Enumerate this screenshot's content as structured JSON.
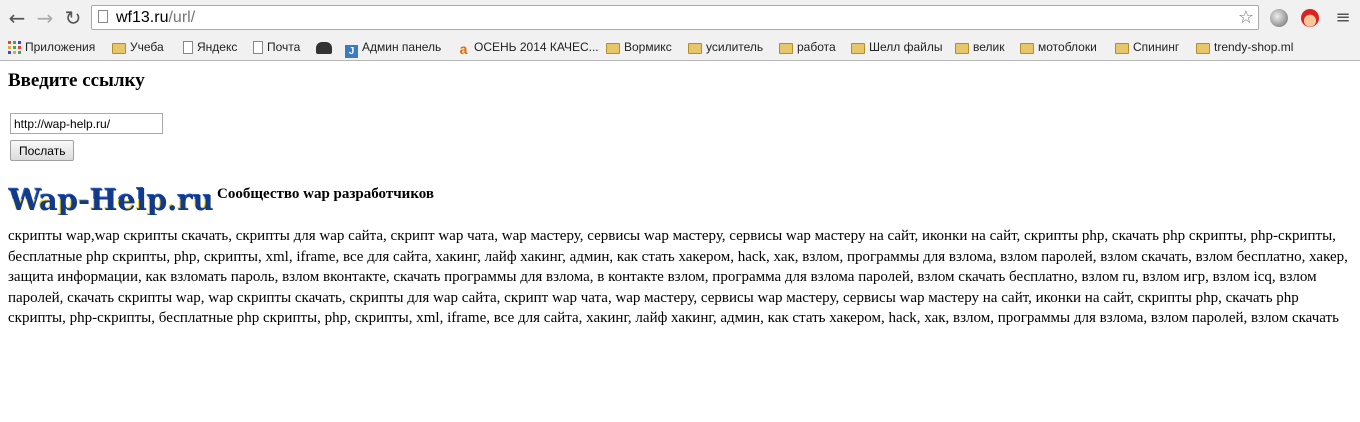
{
  "browser": {
    "url_host": "wf13.ru",
    "url_path": "/url/",
    "icons": [
      "back-icon",
      "forward-icon",
      "reload-icon",
      "star-icon",
      "globe-icon",
      "santa-icon",
      "menu-icon"
    ]
  },
  "bookmarks": [
    {
      "label": "Приложения",
      "icon": "apps-grid-icon"
    },
    {
      "label": "Учеба",
      "icon": "folder-icon"
    },
    {
      "label": "Яндекс",
      "icon": "page-icon"
    },
    {
      "label": "Почта",
      "icon": "page-icon"
    },
    {
      "label": "",
      "icon": "spy-icon"
    },
    {
      "label": "Админ панель",
      "icon": "joomla-icon"
    },
    {
      "label": "ОСЕНЬ 2014 КАЧЕС...",
      "icon": "a-letter-icon"
    },
    {
      "label": "Вормикс",
      "icon": "folder-icon"
    },
    {
      "label": "усилитель",
      "icon": "folder-icon"
    },
    {
      "label": "работа",
      "icon": "folder-icon"
    },
    {
      "label": "Шелл файлы",
      "icon": "folder-icon"
    },
    {
      "label": "велик",
      "icon": "folder-icon"
    },
    {
      "label": "мотоблоки",
      "icon": "folder-icon"
    },
    {
      "label": "Спининг",
      "icon": "folder-icon"
    },
    {
      "label": "trendy-shop.ml",
      "icon": "folder-icon"
    }
  ],
  "page": {
    "heading": "Введите ссылку",
    "input_value": "http://wap-help.ru/",
    "submit_label": "Послать",
    "logo_text": "Wap-Help.ru",
    "tagline": "Сообщество wap разработчиков",
    "keywords": "скрипты wap,wap скрипты скачать, скрипты для wap сайта, скрипт wap чата, wap мастеру, сервисы wap мастеру, сервисы wap мастеру на сайт, иконки на сайт, скрипты php, скачать php скрипты, php-скрипты, бесплатные php скрипты, php, скрипты, xml, iframe, все для сайта, хакинг, лайф хакинг, админ, как стать хакером, hack, хак, взлом, программы для взлома, взлом паролей, взлом скачать, взлом бесплатно, хакер, защита информации, как взломать пароль, взлом вконтакте, скачать программы для взлома, в контакте взлом, программа для взлома паролей, взлом скачать бесплатно, взлом ru, взлом игр, взлом icq, взлом паролей, скачать скрипты wap, wap скрипты скачать, скрипты для wap сайта, скрипт wap чата, wap мастеру, сервисы wap мастеру, сервисы wap мастеру на сайт, иконки на сайт, скрипты php, скачать php скрипты, php-скрипты, бесплатные php скрипты, php, скрипты, xml, iframe, все для сайта, хакинг, лайф хакинг, админ, как стать хакером, hack, хак, взлом, программы для взлома, взлом паролей, взлом скачать"
  }
}
